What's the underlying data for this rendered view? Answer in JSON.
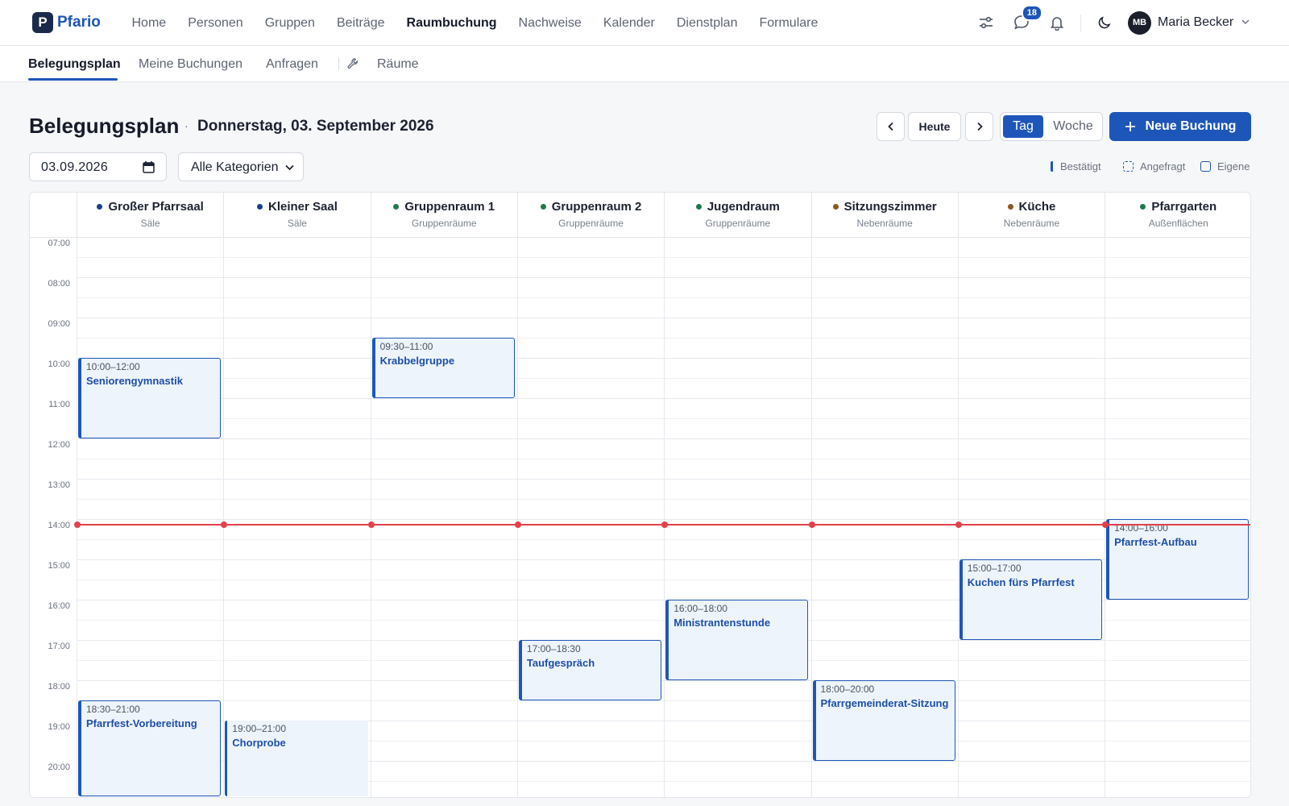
{
  "brand": {
    "name": "Pfario",
    "mark": "P"
  },
  "nav": {
    "items": [
      "Home",
      "Personen",
      "Gruppen",
      "Beiträge",
      "Raumbuchung",
      "Nachweise",
      "Kalender",
      "Dienstplan",
      "Formulare"
    ],
    "active": "Raumbuchung"
  },
  "header_right": {
    "messages_badge": "18",
    "avatar_initials": "MB",
    "user_name": "Maria Becker"
  },
  "subnav": {
    "tabs": [
      "Belegungsplan",
      "Meine Buchungen",
      "Anfragen",
      "Räume"
    ],
    "active": "Belegungsplan"
  },
  "page": {
    "title": "Belegungsplan",
    "separator": "·",
    "date_label": "Donnerstag, 03. September 2026"
  },
  "toolbar": {
    "today_label": "Heute",
    "view_day": "Tag",
    "view_week": "Woche",
    "view_active": "Tag",
    "new_booking_label": "Neue Buchung"
  },
  "filters": {
    "date_value": "03.09.2026",
    "category_value": "Alle Kategorien"
  },
  "legend": {
    "confirmed": "Bestätigt",
    "requested": "Angefragt",
    "own": "Eigene"
  },
  "rooms": [
    {
      "name": "Großer Pfarrsaal",
      "category": "Säle",
      "color": "#1d3f8a"
    },
    {
      "name": "Kleiner Saal",
      "category": "Säle",
      "color": "#1d3f8a"
    },
    {
      "name": "Gruppenraum 1",
      "category": "Gruppenräume",
      "color": "#1f7a4a"
    },
    {
      "name": "Gruppenraum 2",
      "category": "Gruppenräume",
      "color": "#1f7a4a"
    },
    {
      "name": "Jugendraum",
      "category": "Gruppenräume",
      "color": "#1f7a4a"
    },
    {
      "name": "Sitzungszimmer",
      "category": "Nebenräume",
      "color": "#8a5a1d"
    },
    {
      "name": "Küche",
      "category": "Nebenräume",
      "color": "#8a5a1d"
    },
    {
      "name": "Pfarrgarten",
      "category": "Außenflächen",
      "color": "#1f7a4a"
    }
  ],
  "hours": [
    "07:00",
    "08:00",
    "09:00",
    "10:00",
    "11:00",
    "12:00",
    "13:00",
    "14:00",
    "15:00",
    "16:00",
    "17:00",
    "18:00",
    "19:00",
    "20:00"
  ],
  "now_time": "14:07",
  "events": [
    {
      "room": 0,
      "start": "10:00",
      "end": "12:00",
      "time_label": "10:00–12:00",
      "title": "Seniorengymnastik",
      "status": "own"
    },
    {
      "room": 2,
      "start": "09:30",
      "end": "11:00",
      "time_label": "09:30–11:00",
      "title": "Krabbelgruppe",
      "status": "own"
    },
    {
      "room": 7,
      "start": "14:00",
      "end": "16:00",
      "time_label": "14:00–16:00",
      "title": "Pfarrfest-Aufbau",
      "status": "own"
    },
    {
      "room": 6,
      "start": "15:00",
      "end": "17:00",
      "time_label": "15:00–17:00",
      "title": "Kuchen fürs Pfarrfest",
      "status": "own"
    },
    {
      "room": 4,
      "start": "16:00",
      "end": "18:00",
      "time_label": "16:00–18:00",
      "title": "Ministrantenstunde",
      "status": "own"
    },
    {
      "room": 3,
      "start": "17:00",
      "end": "18:30",
      "time_label": "17:00–18:30",
      "title": "Taufgespräch",
      "status": "own"
    },
    {
      "room": 5,
      "start": "18:00",
      "end": "20:00",
      "time_label": "18:00–20:00",
      "title": "Pfarrgemeinderat-Sitzung",
      "status": "own"
    },
    {
      "room": 0,
      "start": "18:30",
      "end": "21:00",
      "time_label": "18:30–21:00",
      "title": "Pfarrfest-Vorbereitung",
      "status": "own"
    },
    {
      "room": 1,
      "start": "19:00",
      "end": "21:00",
      "time_label": "19:00–21:00",
      "title": "Chorprobe",
      "status": "confirmed"
    }
  ]
}
